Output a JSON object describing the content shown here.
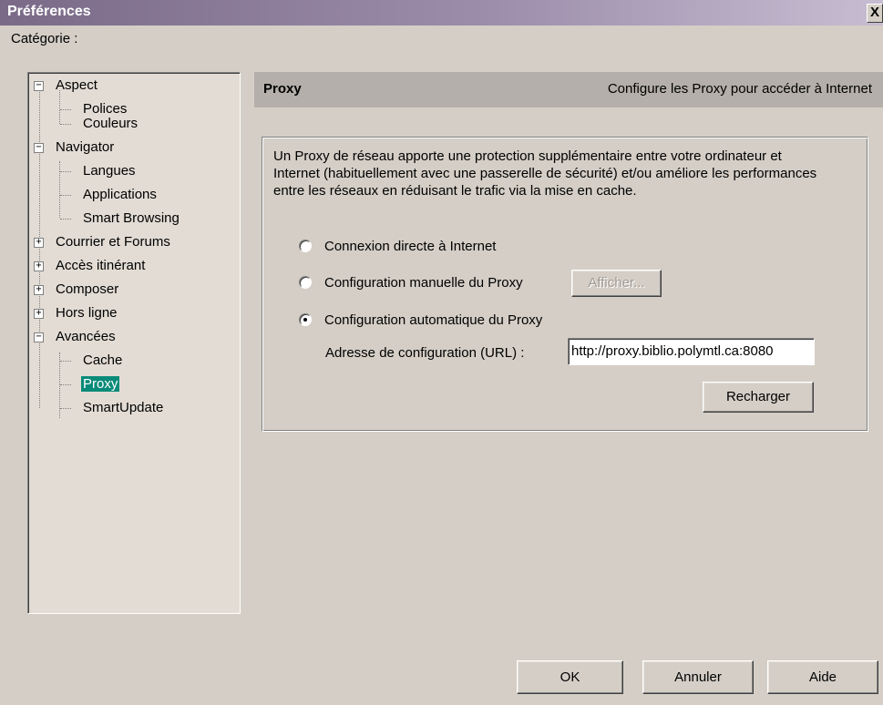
{
  "window": {
    "title": "Préférences",
    "close_glyph": "X"
  },
  "category_label": "Catégorie :",
  "tree": {
    "aspect": "Aspect",
    "polices": "Polices",
    "couleurs": "Couleurs",
    "navigator": "Navigator",
    "langues": "Langues",
    "applications": "Applications",
    "smart_browsing": "Smart Browsing",
    "courrier": "Courrier et Forums",
    "acces": "Accès itinérant",
    "composer": "Composer",
    "hors_ligne": "Hors ligne",
    "avancees": "Avancées",
    "cache": "Cache",
    "proxy": "Proxy",
    "smartupdate": "SmartUpdate",
    "expand_glyph": "+",
    "collapse_glyph": "−"
  },
  "panel": {
    "title": "Proxy",
    "description": "Configure les Proxy pour accéder à Internet"
  },
  "proxy": {
    "intro": "Un Proxy de réseau apporte une protection supplémentaire entre votre ordinateur et Internet (habituellement avec une passerelle de sécurité) et/ou améliore les performances entre les réseaux en réduisant le trafic via la mise en cache.",
    "option_direct": "Connexion directe à Internet",
    "option_manual": "Configuration manuelle du Proxy",
    "option_auto": "Configuration automatique du Proxy",
    "selected_option": "auto",
    "afficher_button": "Afficher...",
    "url_label": "Adresse de configuration (URL) :",
    "url_value": "http://proxy.biblio.polymtl.ca:8080",
    "reload_button": "Recharger"
  },
  "footer": {
    "ok": "OK",
    "cancel": "Annuler",
    "help": "Aide"
  },
  "colors": {
    "selection": "#0a8b79",
    "title_bar": "#7a6a88",
    "face": "#d4cec6"
  }
}
